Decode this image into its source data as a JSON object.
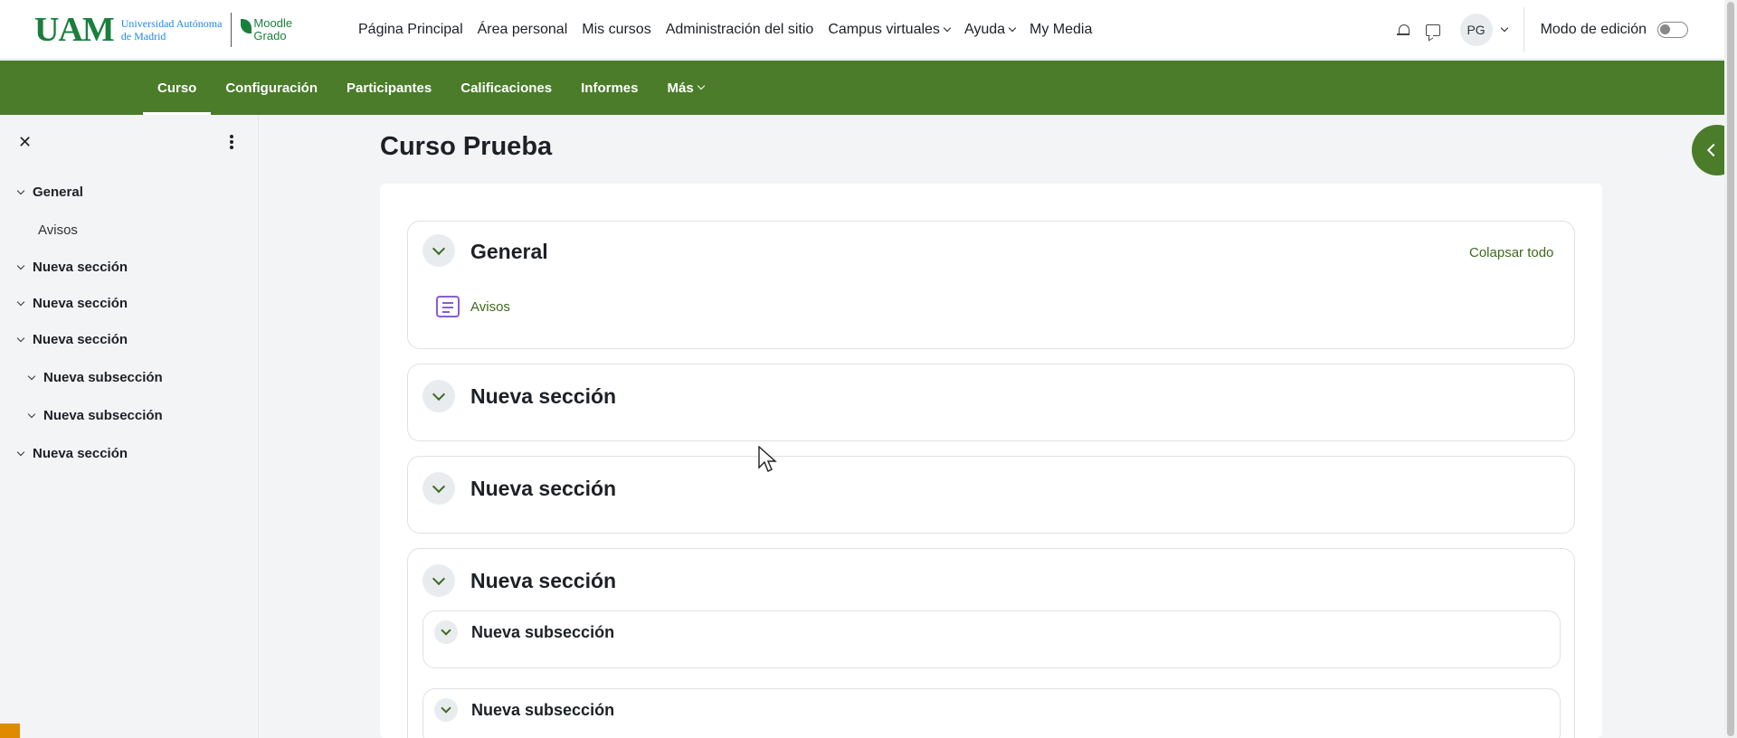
{
  "brand": {
    "uam": "UAM",
    "university_line1": "Universidad Autónoma",
    "university_line2": "de Madrid",
    "moodle_line1": "Moodle",
    "moodle_line2": "Grado"
  },
  "main_nav": [
    {
      "label": "Página Principal"
    },
    {
      "label": "Área personal"
    },
    {
      "label": "Mis cursos"
    },
    {
      "label": "Administración del sitio"
    },
    {
      "label": "Campus virtuales"
    },
    {
      "label": "Ayuda"
    },
    {
      "label": "My Media"
    }
  ],
  "user": {
    "initials": "PG"
  },
  "edit_mode": {
    "label": "Modo de edición",
    "on": false
  },
  "course_nav": [
    {
      "label": "Curso",
      "active": true
    },
    {
      "label": "Configuración"
    },
    {
      "label": "Participantes"
    },
    {
      "label": "Calificaciones"
    },
    {
      "label": "Informes"
    },
    {
      "label": "Más"
    }
  ],
  "course_index": [
    {
      "label": "General"
    },
    {
      "label": "Avisos"
    },
    {
      "label": "Nueva sección"
    },
    {
      "label": "Nueva sección"
    },
    {
      "label": "Nueva sección"
    },
    {
      "label": "Nueva subsección"
    },
    {
      "label": "Nueva subsección"
    },
    {
      "label": "Nueva sección"
    }
  ],
  "course": {
    "title": "Curso Prueba",
    "collapse_all": "Colapsar todo",
    "sections": [
      {
        "title": "General",
        "activity": "Avisos"
      },
      {
        "title": "Nueva sección"
      },
      {
        "title": "Nueva sección"
      },
      {
        "title": "Nueva sección"
      }
    ],
    "subsections": [
      {
        "title": "Nueva subsección"
      },
      {
        "title": "Nueva subsección"
      }
    ]
  },
  "colors": {
    "brand_green": "#4a7c2a",
    "link_green": "#3e6b1e",
    "forum_purple": "#8a5cd6"
  }
}
